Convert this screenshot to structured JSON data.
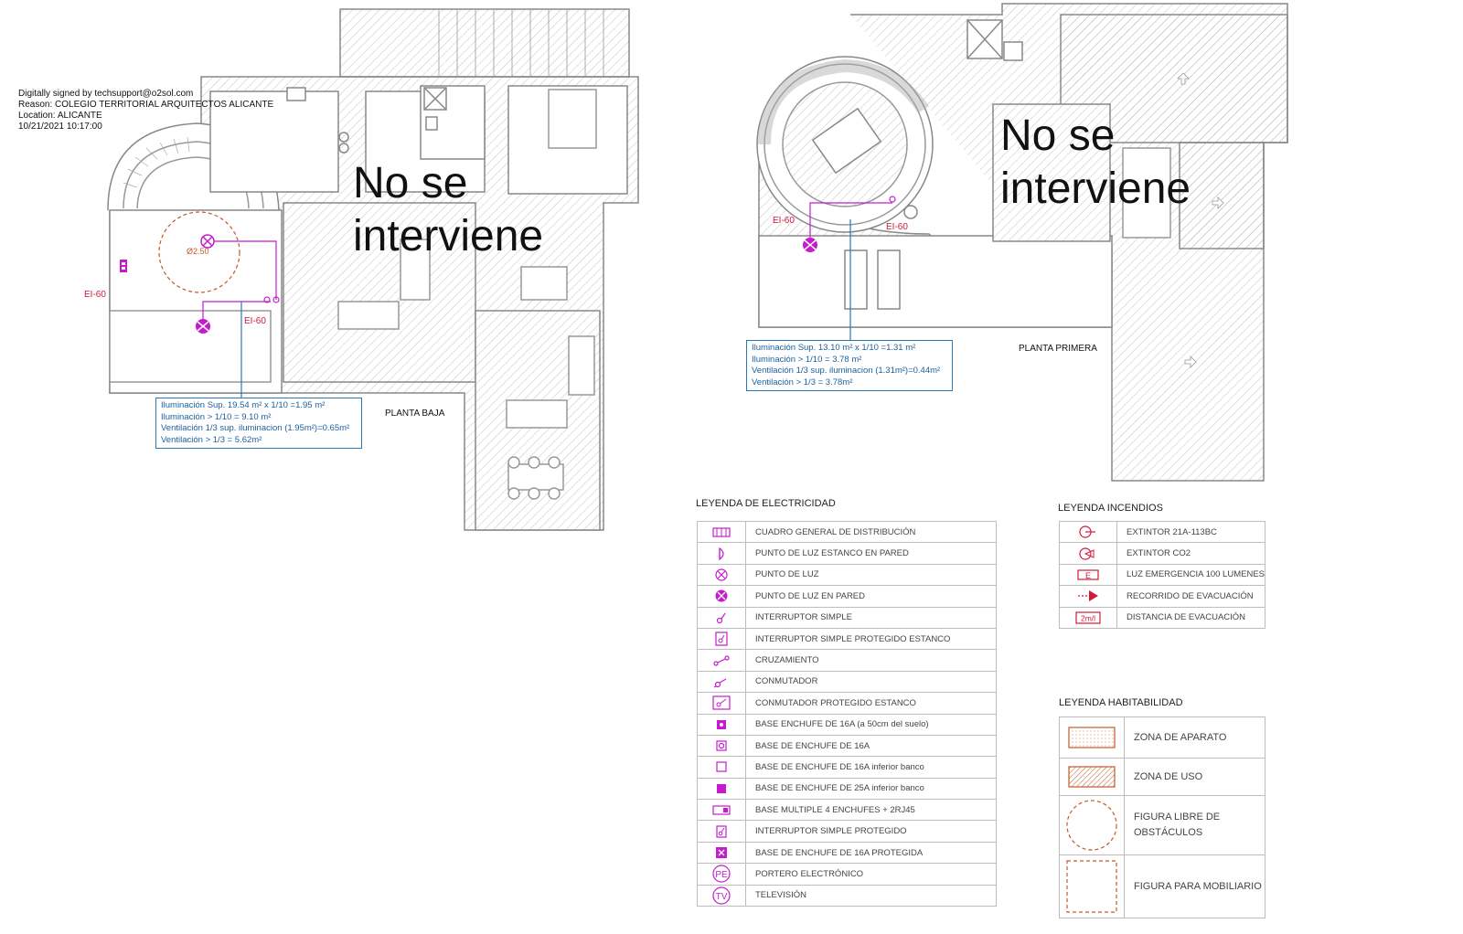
{
  "signature": {
    "line1": "Digitally signed by techsupport@o2sol.com",
    "line2": "Reason: COLEGIO TERRITORIAL ARQUITECTOS ALICANTE",
    "line3": "Location: ALICANTE",
    "line4": "10/21/2021 10:17:00"
  },
  "plans": {
    "ground": {
      "label": "PLANTA BAJA",
      "no_intervention_line1": "No se",
      "no_intervention_line2": "interviene",
      "ei_left": "EI-60",
      "ei_right": "EI-60",
      "diameter": "Ø2.50",
      "calc": [
        "Iluminación Sup. 19.54 m² x 1/10 =1.95 m²",
        "Iluminación  > 1/10 = 9.10 m²",
        "Ventilación  1/3 sup. iluminacion (1.95m²)=0.65m²",
        "Ventilación > 1/3 = 5.62m²"
      ]
    },
    "first": {
      "label": "PLANTA PRIMERA",
      "no_intervention_line1": "No se",
      "no_intervention_line2": "interviene",
      "ei_left": "EI-60",
      "ei_right": "EI-60",
      "calc": [
        "Iluminación Sup. 13.10 m² x 1/10 =1.31 m²",
        "Iluminación  > 1/10 = 3.78 m²",
        "Ventilación  1/3 sup. iluminacion (1.31m²)=0.44m²",
        "Ventilación > 1/3 = 3.78m²"
      ]
    }
  },
  "legend_electricity": {
    "title": "LEYENDA DE ELECTRICIDAD",
    "items": [
      {
        "label": "CUADRO GENERAL DE DISTRIBUCIÓN",
        "icon": "distribution-panel-icon"
      },
      {
        "label": "PUNTO DE LUZ ESTANCO EN PARED",
        "icon": "waterproof-wall-light-icon"
      },
      {
        "label": "PUNTO DE LUZ",
        "icon": "light-point-icon"
      },
      {
        "label": "PUNTO DE LUZ EN PARED",
        "icon": "wall-light-icon"
      },
      {
        "label": "INTERRUPTOR SIMPLE",
        "icon": "simple-switch-icon"
      },
      {
        "label": "INTERRUPTOR SIMPLE PROTEGIDO ESTANCO",
        "icon": "protected-waterproof-switch-icon"
      },
      {
        "label": "CRUZAMIENTO",
        "icon": "crossover-switch-icon"
      },
      {
        "label": "CONMUTADOR",
        "icon": "two-way-switch-icon"
      },
      {
        "label": "CONMUTADOR PROTEGIDO ESTANCO",
        "icon": "protected-two-way-switch-icon"
      },
      {
        "label": "BASE  ENCHUFE DE 16A (a 50cm del suelo)",
        "icon": "socket-16a-50cm-icon"
      },
      {
        "label": "BASE DE ENCHUFE DE 16A",
        "icon": "socket-16a-icon"
      },
      {
        "label": "BASE DE ENCHUFE DE 16A inferior banco",
        "icon": "socket-16a-under-counter-icon"
      },
      {
        "label": "BASE DE ENCHUFE DE 25A inferior banco",
        "icon": "socket-25a-under-counter-icon"
      },
      {
        "label": "BASE MULTIPLE  4 ENCHUFES + 2RJ45",
        "icon": "multi-socket-icon"
      },
      {
        "label": "INTERRUPTOR SIMPLE PROTEGIDO",
        "icon": "protected-switch-icon"
      },
      {
        "label": "BASE DE ENCHUFE DE 16A PROTEGIDA",
        "icon": "protected-socket-icon"
      },
      {
        "label": "PORTERO ELECTRÓNICO",
        "icon": "intercom-icon",
        "glyph": "PE"
      },
      {
        "label": "TELEVISIÓN",
        "icon": "television-icon",
        "glyph": "TV"
      }
    ]
  },
  "legend_fire": {
    "title": "LEYENDA INCENDIOS",
    "items": [
      {
        "label": "EXTINTOR 21A-113BC",
        "icon": "extinguisher-icon"
      },
      {
        "label": "EXTINTOR CO2",
        "icon": "co2-extinguisher-icon"
      },
      {
        "label": "LUZ EMERGENCIA 100 LUMENES",
        "icon": "emergency-light-icon",
        "glyph": "E"
      },
      {
        "label": "RECORRIDO DE EVACUACIÓN",
        "icon": "evacuation-route-icon"
      },
      {
        "label": "DISTANCIA DE EVACUACIÓN",
        "icon": "evacuation-distance-icon",
        "glyph": "2m/l"
      }
    ]
  },
  "legend_habitability": {
    "title": "LEYENDA HABITABILIDAD",
    "items": [
      {
        "label": "ZONA DE APARATO",
        "icon": "appliance-zone-icon"
      },
      {
        "label": "ZONA DE USO",
        "icon": "use-zone-icon"
      },
      {
        "label": "FIGURA LIBRE DE OBSTÁCULOS",
        "icon": "free-circle-icon"
      },
      {
        "label": "FIGURA PARA MOBILIARIO",
        "icon": "furniture-figure-icon"
      }
    ]
  },
  "colors": {
    "wall": "#888888",
    "hatch": "#b3b3b3",
    "magenta": "#c41ccc",
    "fire_red": "#d11a3a",
    "calc_blue": "#2a78b8",
    "orange": "#c25a2a"
  }
}
